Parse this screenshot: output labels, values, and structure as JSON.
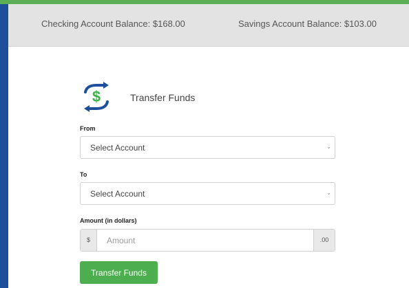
{
  "balances": {
    "checking": "Checking Account Balance: $168.00",
    "savings": "Savings Account Balance: $103.00"
  },
  "form": {
    "title": "Transfer Funds",
    "icon": "transfer-money-icon",
    "from": {
      "label": "From",
      "selected": "Select Account"
    },
    "to": {
      "label": "To",
      "selected": "Select Account"
    },
    "amount": {
      "label": "Amount (in dollars)",
      "prefix": "$",
      "placeholder": "Amount",
      "suffix": ".00"
    },
    "submit_label": "Transfer Funds"
  },
  "colors": {
    "frame": "#1f4f9a",
    "accent_green": "#4cae4f",
    "icon_blue": "#1f4f9a",
    "icon_green": "#3cb44a"
  }
}
